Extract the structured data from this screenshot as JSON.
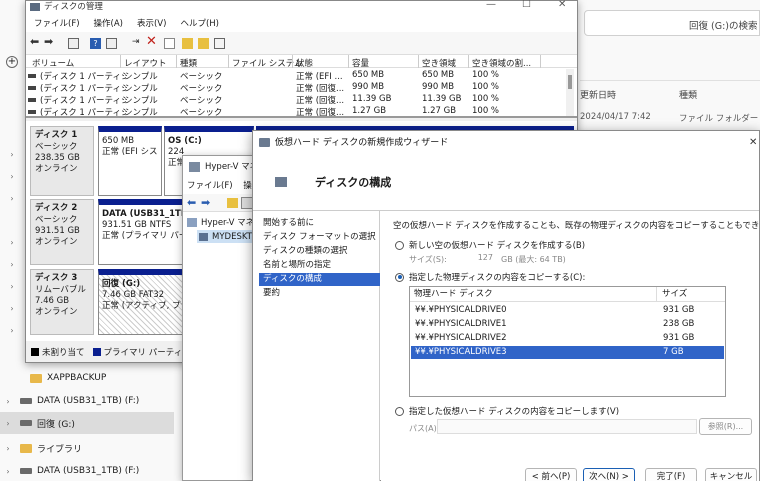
{
  "explorer": {
    "search_placeholder": "回復 (G:)の検索",
    "columns": {
      "date": "更新日時",
      "type": "種類"
    },
    "row": {
      "date": "2024/04/17 7:42",
      "type": "ファイル フォルダー"
    },
    "nav": [
      {
        "label": "XAPPBACKUP",
        "icon": "folder"
      },
      {
        "label": "DATA (USB31_1TB) (F:)",
        "icon": "drive"
      },
      {
        "label": "回復 (G:)",
        "icon": "drive"
      },
      {
        "label": "ライブラリ",
        "icon": "folder"
      },
      {
        "label": "DATA (USB31_1TB) (F:)",
        "icon": "drive"
      }
    ]
  },
  "disk_management": {
    "title": "ディスクの管理",
    "menu": [
      "ファイル(F)",
      "操作(A)",
      "表示(V)",
      "ヘルプ(H)"
    ],
    "columns": [
      "ボリューム",
      "レイアウト",
      "種類",
      "ファイル システム",
      "状態",
      "容量",
      "空き領域",
      "空き領域の割..."
    ],
    "volumes": [
      [
        "(ディスク 1 パーティシ...",
        "シンプル",
        "ベーシック",
        "",
        "正常 (EFI ...",
        "650 MB",
        "650 MB",
        "100 %"
      ],
      [
        "(ディスク 1 パーティシ...",
        "シンプル",
        "ベーシック",
        "",
        "正常 (回復...",
        "990 MB",
        "990 MB",
        "100 %"
      ],
      [
        "(ディスク 1 パーティシ...",
        "シンプル",
        "ベーシック",
        "",
        "正常 (回復...",
        "11.39 GB",
        "11.39 GB",
        "100 %"
      ],
      [
        "(ディスク 1 パーティシ...",
        "シンプル",
        "ベーシック",
        "",
        "正常 (回復...",
        "1.27 GB",
        "1.27 GB",
        "100 %"
      ]
    ],
    "disks": [
      {
        "name": "ディスク 1",
        "type": "ベーシック",
        "size": "238.35 GB",
        "status": "オンライン",
        "parts": [
          {
            "l1": "",
            "l2": "650 MB",
            "l3": "正常 (EFI シス"
          },
          {
            "l1": "OS (C:)",
            "l2": "224",
            "l3": "正常"
          }
        ]
      },
      {
        "name": "ディスク 2",
        "type": "ベーシック",
        "size": "931.51 GB",
        "status": "オンライン",
        "parts": [
          {
            "l1": "DATA (USB31_1TB)",
            "l2": "931.51 GB NTFS",
            "l3": "正常 (プライマリ パーティ"
          }
        ]
      },
      {
        "name": "ディスク 3",
        "type": "リムーバブル",
        "size": "7.46 GB",
        "status": "オンライン",
        "parts": [
          {
            "l1": "回復 (G:)",
            "l2": "7.46 GB FAT32",
            "l3": "正常 (アクティブ, プライ"
          }
        ]
      }
    ],
    "legend": [
      "未割り当て",
      "プライマリ パーティション"
    ],
    "colors": {
      "unallocated": "#000000",
      "primary": "#0a1f8f"
    }
  },
  "hyperv": {
    "title": "Hyper-V マネー",
    "menu": [
      "ファイル(F)",
      "操作"
    ],
    "tree": [
      "Hyper-V マネ",
      "MYDESKT"
    ]
  },
  "wizard": {
    "title": "仮想ハード ディスクの新規作成ウィザード",
    "header": "ディスクの構成",
    "steps": [
      "開始する前に",
      "ディスク フォーマットの選択",
      "ディスクの種類の選択",
      "名前と場所の指定",
      "ディスクの構成",
      "要約"
    ],
    "active_step": 4,
    "description": "空の仮想ハード ディスクを作成することも、既存の物理ディスクの内容をコピーすることもできます。",
    "option_new": "新しい空の仮想ハード ディスクを作成する(B)",
    "size_label": "サイズ(S):",
    "size_value": "127",
    "size_unit": "GB (最大: 64 TB)",
    "option_copy_physical": "指定した物理ディスクの内容をコピーする(C):",
    "list_columns": [
      "物理ハード ディスク",
      "サイズ"
    ],
    "physical_disks": [
      {
        "name": "¥¥.¥PHYSICALDRIVE0",
        "size": "931 GB"
      },
      {
        "name": "¥¥.¥PHYSICALDRIVE1",
        "size": "238 GB"
      },
      {
        "name": "¥¥.¥PHYSICALDRIVE2",
        "size": "931 GB"
      },
      {
        "name": "¥¥.¥PHYSICALDRIVE3",
        "size": "7 GB"
      }
    ],
    "selected_disk": 3,
    "option_copy_virtual": "指定した仮想ハード ディスクの内容をコピーします(V)",
    "path_label": "パス(A):",
    "browse_button": "参照(R)...",
    "buttons": {
      "back": "< 前へ(P)",
      "next": "次へ(N) >",
      "finish": "完了(F)",
      "cancel": "キャンセル"
    },
    "colors": {
      "selection": "#3064c8",
      "accent": "#1a5fb4"
    }
  }
}
